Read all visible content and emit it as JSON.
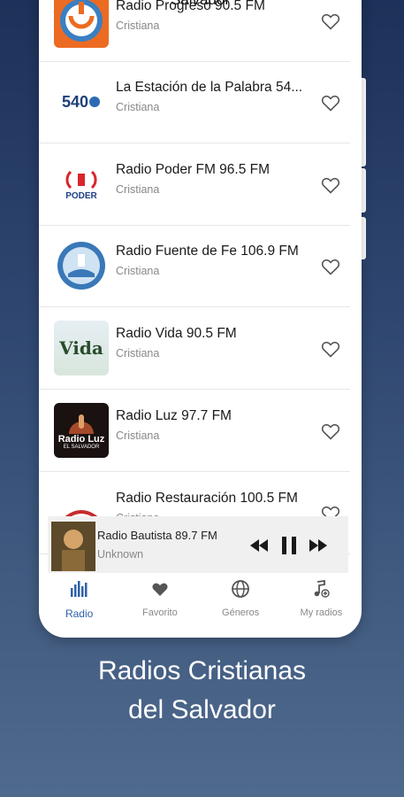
{
  "header": {
    "title": "Salvador"
  },
  "stations": [
    {
      "name": "Radio Progreso 90.5 FM",
      "genre": "Cristiana"
    },
    {
      "name": "La Estación de la Palabra 54...",
      "genre": "Cristiana"
    },
    {
      "name": "Radio Poder FM 96.5 FM",
      "genre": "Cristiana"
    },
    {
      "name": "Radio Fuente de Fe 106.9 FM",
      "genre": "Cristiana"
    },
    {
      "name": "Radio Vida 90.5 FM",
      "genre": "Cristiana"
    },
    {
      "name": "Radio Luz 97.7 FM",
      "genre": "Cristiana"
    },
    {
      "name": "Radio Restauración 100.5 FM",
      "genre": "Cristiana"
    }
  ],
  "logos": {
    "estacion": "540",
    "poder": "PODER",
    "luz": "Radio Luz",
    "luz_sub": "EL SALVADOR",
    "vida": "Vida"
  },
  "player": {
    "title": "Radio Bautista 89.7 FM",
    "subtitle": "Unknown"
  },
  "nav": [
    {
      "label": "Radio",
      "icon": "equalizer-icon",
      "active": true
    },
    {
      "label": "Favorito",
      "icon": "heart-icon",
      "active": false
    },
    {
      "label": "Géneros",
      "icon": "globe-icon",
      "active": false
    },
    {
      "label": "My radios",
      "icon": "music-note-plus-icon",
      "active": false
    }
  ],
  "caption": {
    "line1": "Radios Cristianas",
    "line2": "del Salvador"
  },
  "colors": {
    "accent": "#2f60a8",
    "background_top": "#1d3159",
    "background_bottom": "#4f6a8d"
  }
}
